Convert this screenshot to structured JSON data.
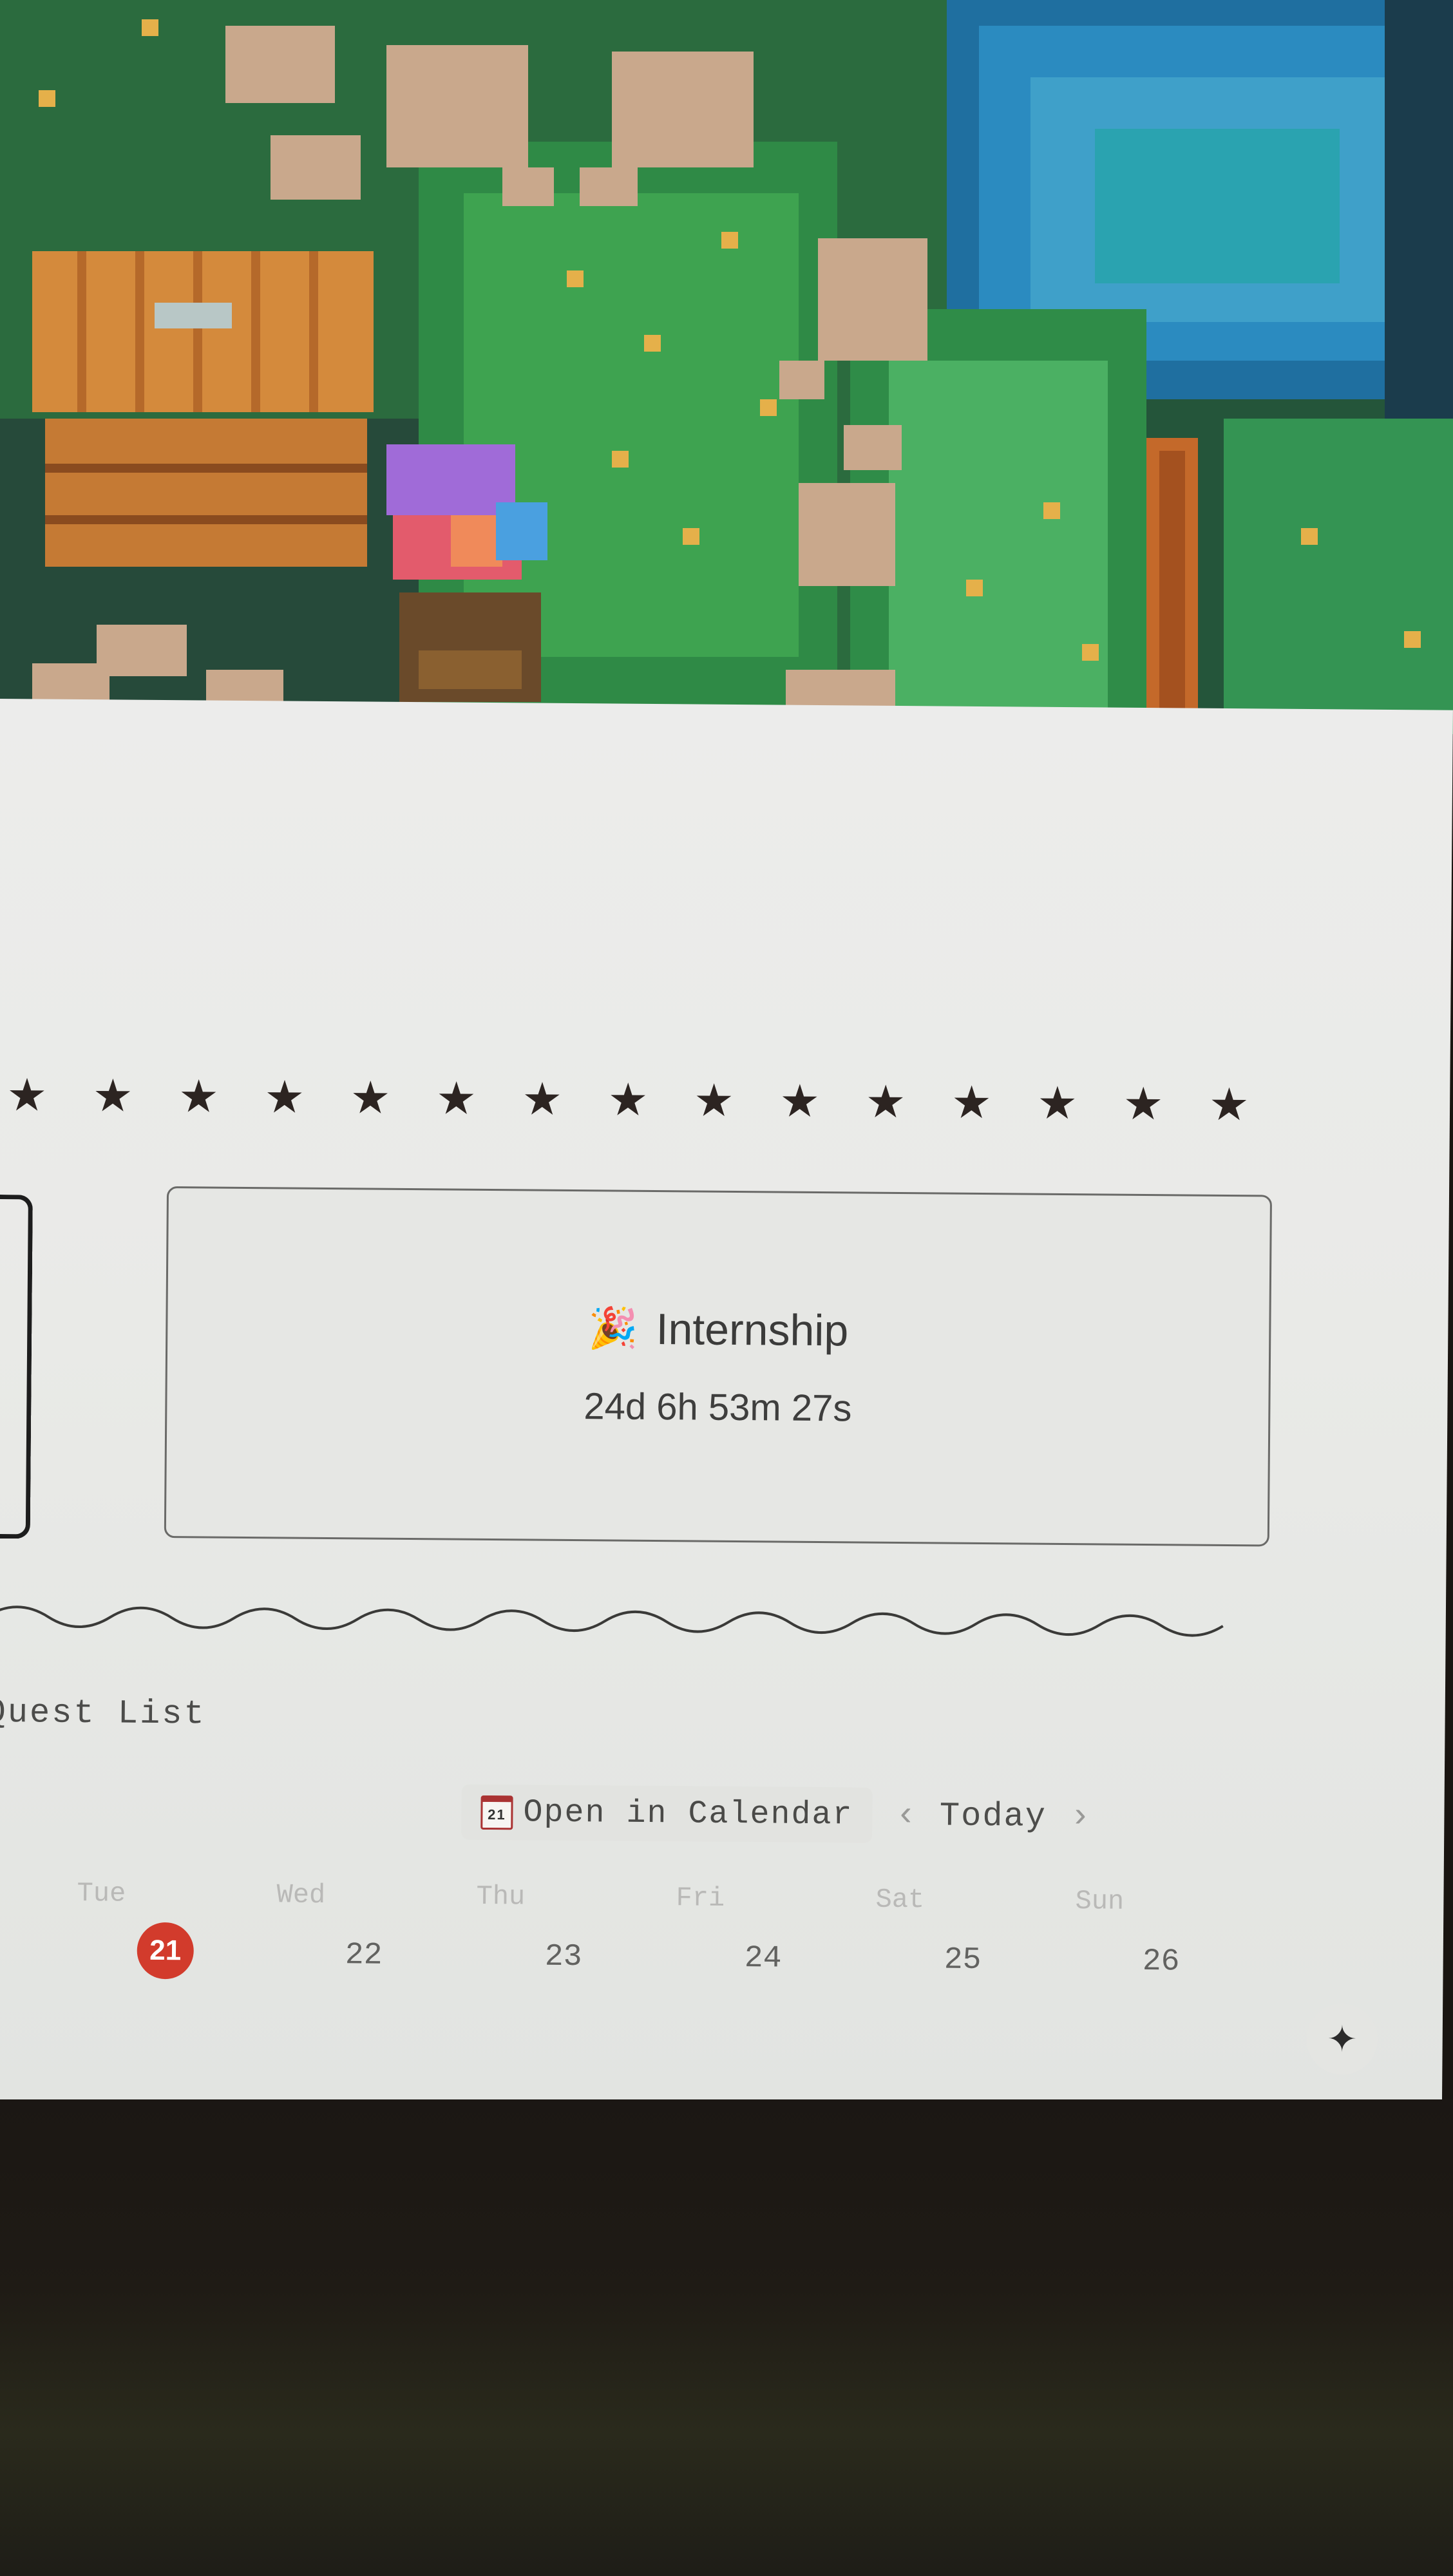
{
  "stars": [
    "★",
    "★",
    "★",
    "★",
    "★",
    "★",
    "★",
    "★",
    "★",
    "★",
    "★",
    "★",
    "★",
    "★",
    "★"
  ],
  "countdown": {
    "emoji": "🎉",
    "title": "Internship",
    "timer": "24d 6h 53m 27s"
  },
  "quest_list": {
    "header": "Quest List",
    "open_in_calendar": "Open in Calendar",
    "calendar_icon_day": "21",
    "prev": "‹",
    "today": "Today",
    "next": "›",
    "weekdays": [
      "Tue",
      "Wed",
      "Thu",
      "Fri",
      "Sat",
      "Sun"
    ],
    "dates": [
      "21",
      "22",
      "23",
      "24",
      "25",
      "26"
    ],
    "today_date": "21",
    "ai_icon": "✦"
  },
  "colors": {
    "today_highlight": "#d23b2c",
    "page_bg": "#ececeb"
  }
}
